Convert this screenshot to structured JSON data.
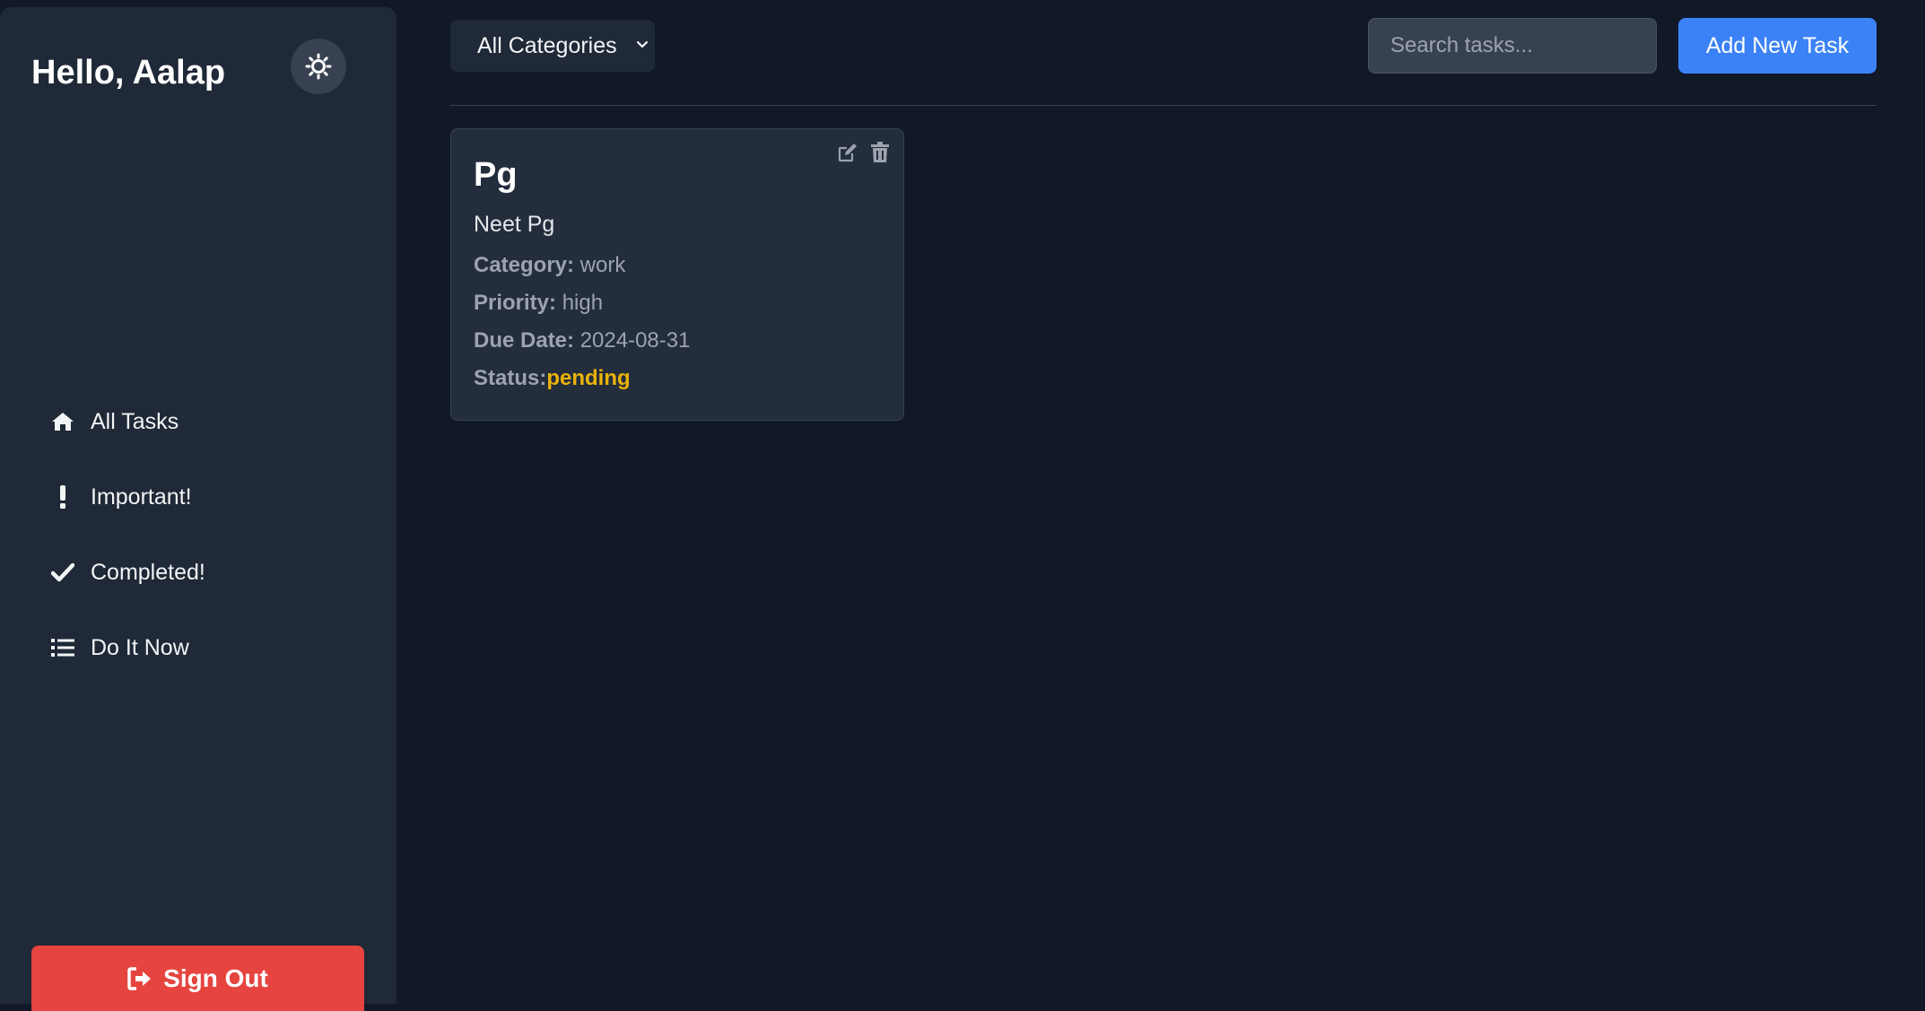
{
  "sidebar": {
    "greeting": "Hello, Aalap",
    "nav": [
      {
        "label": "All Tasks",
        "icon": "home-icon"
      },
      {
        "label": "Important!",
        "icon": "exclamation-icon"
      },
      {
        "label": "Completed!",
        "icon": "check-icon"
      },
      {
        "label": "Do It Now",
        "icon": "list-icon"
      }
    ],
    "signout_label": "Sign Out"
  },
  "toolbar": {
    "category_selected": "All Categories",
    "search_placeholder": "Search tasks...",
    "add_label": "Add New Task"
  },
  "tasks": [
    {
      "title": "Pg",
      "description": "Neet Pg",
      "category_label": "Category:",
      "category": "work",
      "priority_label": "Priority:",
      "priority": "high",
      "due_label": "Due Date:",
      "due": "2024-08-31",
      "status_label": "Status:",
      "status": "pending"
    }
  ],
  "colors": {
    "background": "#111827",
    "sidebar": "#1f2937",
    "accent": "#3b82f6",
    "danger": "#e5443f",
    "status_pending": "#eab308"
  }
}
